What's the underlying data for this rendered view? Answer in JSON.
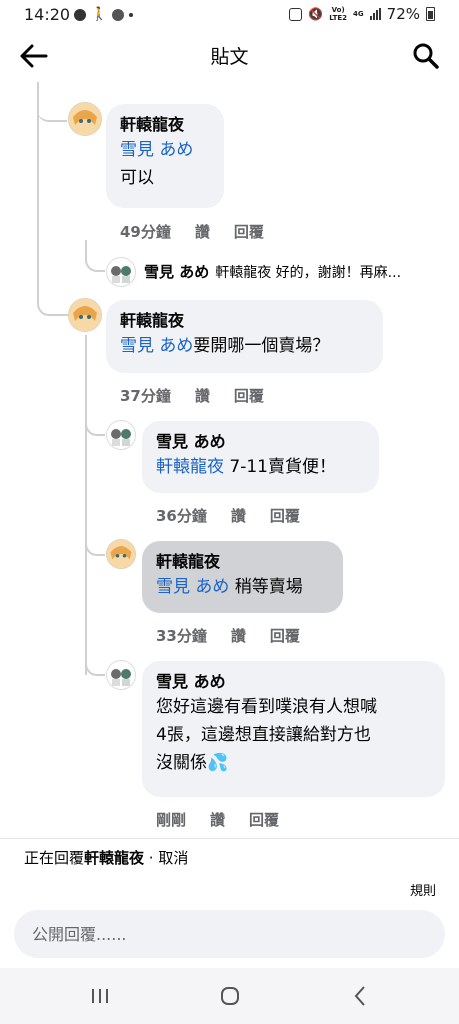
{
  "status_bar": {
    "time": "14:20",
    "network_label": "Vo))\nLTE2",
    "network_4g": "4G",
    "battery": "72%"
  },
  "header": {
    "title": "貼文"
  },
  "comments": [
    {
      "author": "軒轅龍夜",
      "mention": "雪見 あめ",
      "text": "可以",
      "time": "49分鐘",
      "like": "讚",
      "reply": "回覆"
    },
    {
      "author": "雪見 あめ",
      "collapsed_text": "軒轅龍夜 好的，謝謝！再麻..."
    },
    {
      "author": "軒轅龍夜",
      "mention": "雪見 あめ",
      "text": "要開哪一個賣場？",
      "time": "37分鐘",
      "like": "讚",
      "reply": "回覆"
    },
    {
      "author": "雪見 あめ",
      "mention": "軒轅龍夜",
      "text": " 7-11賣貨便！",
      "time": "36分鐘",
      "like": "讚",
      "reply": "回覆"
    },
    {
      "author": "軒轅龍夜",
      "mention": "雪見 あめ",
      "text": " 稍等賣場",
      "time": "33分鐘",
      "like": "讚",
      "reply": "回覆"
    },
    {
      "author": "雪見 あめ",
      "lines": [
        "您好這邊有看到噗浪有人想喊",
        "4張，這邊想直接讓給對方也",
        "沒關係"
      ],
      "emoji": "💦",
      "time": "剛剛",
      "like": "讚",
      "reply": "回覆"
    }
  ],
  "reply_bar": {
    "prefix": "正在回覆",
    "target": "軒轅龍夜",
    "separator": " · ",
    "cancel": "取消",
    "rules": "規則",
    "placeholder": "公開回覆......"
  },
  "colors": {
    "mention": "#1b63c7",
    "bubble": "#f0f2f5",
    "bubble_selected": "#d0d2d6",
    "meta": "#65676b"
  }
}
